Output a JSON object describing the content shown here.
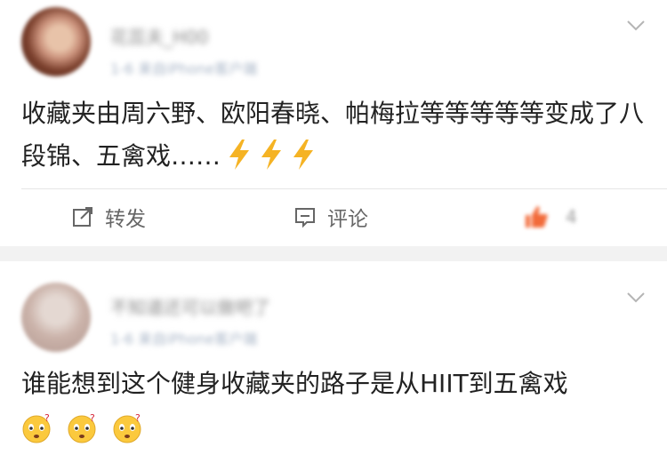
{
  "posts": [
    {
      "username": "花蕊夫_H00",
      "meta": "1-6 来自iPhone客户端",
      "text": "收藏夹由周六野、欧阳春晓、帕梅拉等等等等等变成了八段锦、五禽戏……",
      "emoji": [
        "lightning-emoji",
        "lightning-emoji",
        "lightning-emoji"
      ],
      "actions": {
        "repost_label": "转发",
        "comment_label": "评论",
        "like_count": "4"
      }
    },
    {
      "username": "不知道还可以做吧了",
      "meta": "1-6 来自iPhone客户端",
      "text": "谁能想到这个健身收藏夹的路子是从HIIT到五禽戏",
      "emoji": [
        "thinking-face-emoji",
        "thinking-face-emoji",
        "thinking-face-emoji"
      ]
    }
  ],
  "colors": {
    "lightning": "#f5b324",
    "text": "#222222",
    "action": "#666666",
    "like": "#f26b3a"
  }
}
